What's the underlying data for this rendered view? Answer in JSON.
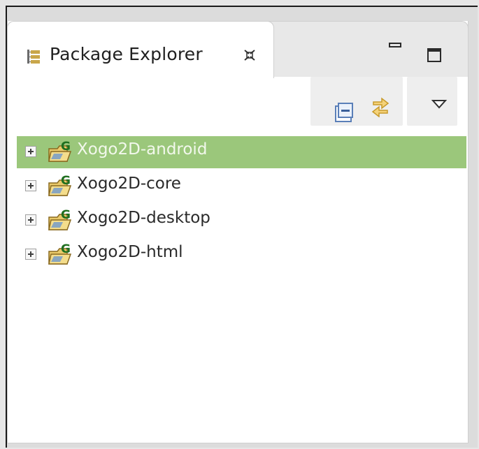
{
  "view": {
    "title": "Package Explorer",
    "close_icon": "close-icon",
    "minimize_icon": "minimize-icon",
    "maximize_icon": "maximize-icon"
  },
  "toolbar": {
    "collapse_all_icon": "collapse-all-icon",
    "link_editor_icon": "link-with-editor-icon",
    "view_menu_icon": "view-menu-icon"
  },
  "tree": {
    "items": [
      {
        "label": "Xogo2D-android",
        "selected": true
      },
      {
        "label": "Xogo2D-core",
        "selected": false
      },
      {
        "label": "Xogo2D-desktop",
        "selected": false
      },
      {
        "label": "Xogo2D-html",
        "selected": false
      }
    ]
  },
  "colors": {
    "selection": "#9bc77b",
    "selected_text": "#f2f8ec",
    "text": "#2a2a2a"
  }
}
